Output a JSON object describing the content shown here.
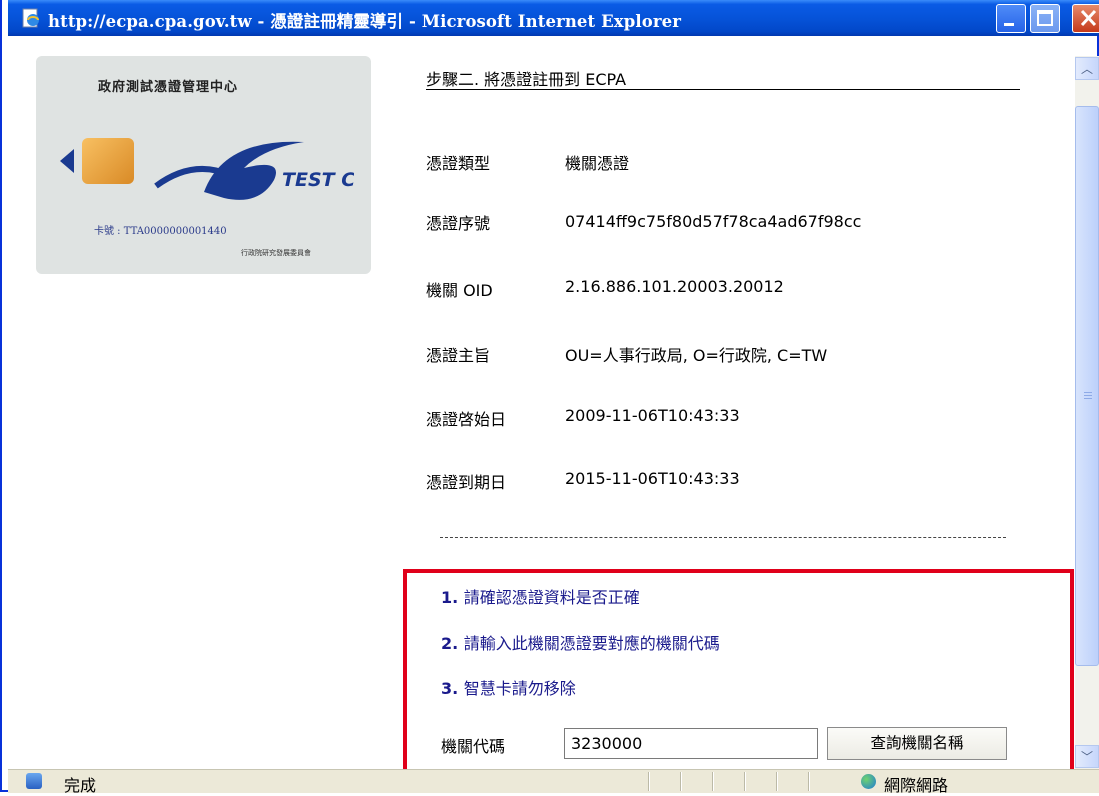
{
  "window": {
    "title": "http://ecpa.cpa.gov.tw - 憑證註冊精靈導引 - Microsoft Internet Explorer"
  },
  "card": {
    "title": "政府測試憑證管理中心",
    "logo_text": "TEST CA",
    "card_number": "卡號 : TTA0000000001440",
    "issuer": "行政院研究發展委員會"
  },
  "step": {
    "title": "步驟二. 將憑證註冊到 ECPA"
  },
  "cert": {
    "type_label": "憑證類型",
    "type_value": "機關憑證",
    "serial_label": "憑證序號",
    "serial_value": "07414ff9c75f80d57f78ca4ad67f98cc",
    "oid_label": "機關 OID",
    "oid_value": "2.16.886.101.20003.20012",
    "subject_label": "憑證主旨",
    "subject_value": "OU=人事行政局, O=行政院, C=TW",
    "start_label": "憑證啓始日",
    "start_value": "2009-11-06T10:43:33",
    "end_label": "憑證到期日",
    "end_value": "2015-11-06T10:43:33"
  },
  "notes": [
    {
      "num": "1.",
      "text": "請確認憑證資料是否正確"
    },
    {
      "num": "2.",
      "text": "請輸入此機關憑證要對應的機關代碼"
    },
    {
      "num": "3.",
      "text": "智慧卡請勿移除"
    }
  ],
  "form": {
    "code_label": "機關代碼",
    "code_value": "3230000",
    "query_button": "查詢機關名稱"
  },
  "status": {
    "text": "完成",
    "zone": "網際網路"
  },
  "colors": {
    "titlebar": "#0653d9",
    "highlight_box": "#e0001a",
    "notes_text": "#1a1a8c"
  }
}
